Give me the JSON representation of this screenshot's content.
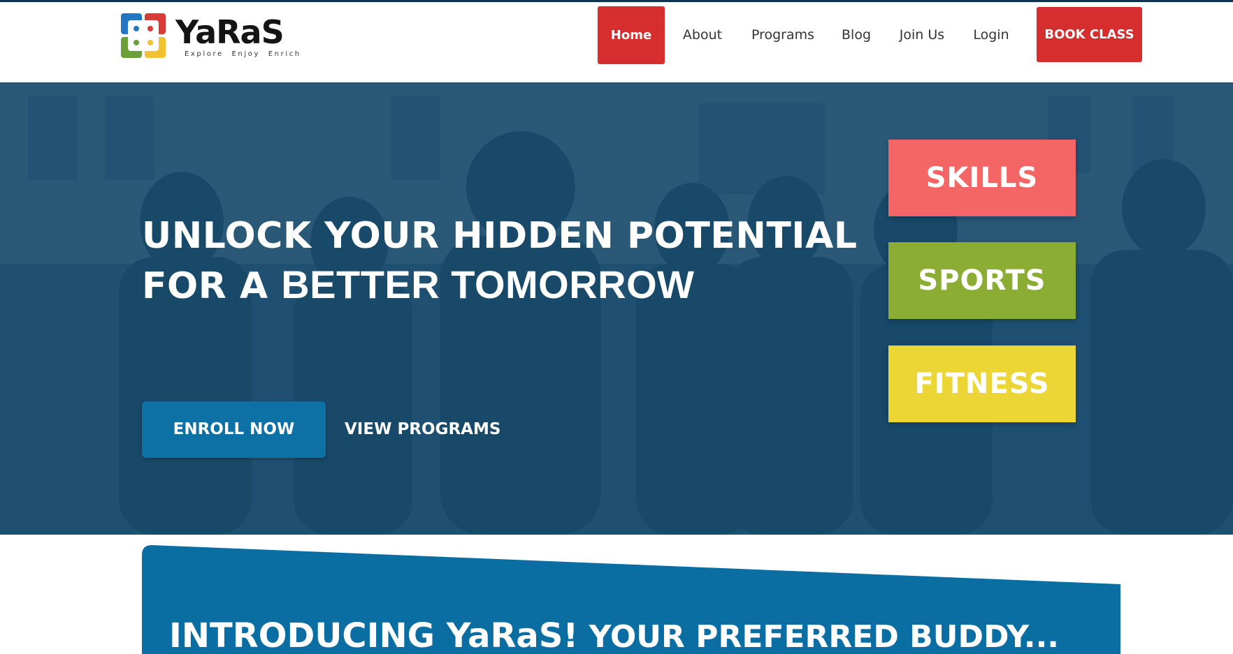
{
  "brand": {
    "name": "YaRaS",
    "tagline": "Explore  Enjoy  Enrich",
    "logo_colors": {
      "blue": "#2277c3",
      "red": "#d83a36",
      "green": "#6a9f3a",
      "yellow": "#f2c230"
    }
  },
  "nav": {
    "items": [
      "Home",
      "About",
      "Programs",
      "Blog",
      "Join Us",
      "Login"
    ],
    "active": "Home",
    "cta": "BOOK CLASS"
  },
  "hero": {
    "headline_line1": "UNLOCK YOUR HIDDEN POTENTIAL",
    "headline_line2_prefix": "FOR A ",
    "headline_line2_bold": "BETTER TOMORROW",
    "enroll_label": "ENROLL NOW",
    "view_label": "VIEW PROGRAMS",
    "tiles": [
      "SKILLS",
      "SPORTS",
      "FITNESS"
    ]
  },
  "intro": {
    "strong": "INTRODUCING YaRaS!",
    "rest": " YOUR PREFERRED BUDDY..."
  },
  "colors": {
    "brand_red": "#d62e2f",
    "hero_overlay": "#0e4266",
    "enroll_blue": "#0e71a6",
    "skills": "#f36665",
    "sports": "#8cad34",
    "fitness": "#ecd635",
    "intro_blue": "#0b6ea3"
  }
}
